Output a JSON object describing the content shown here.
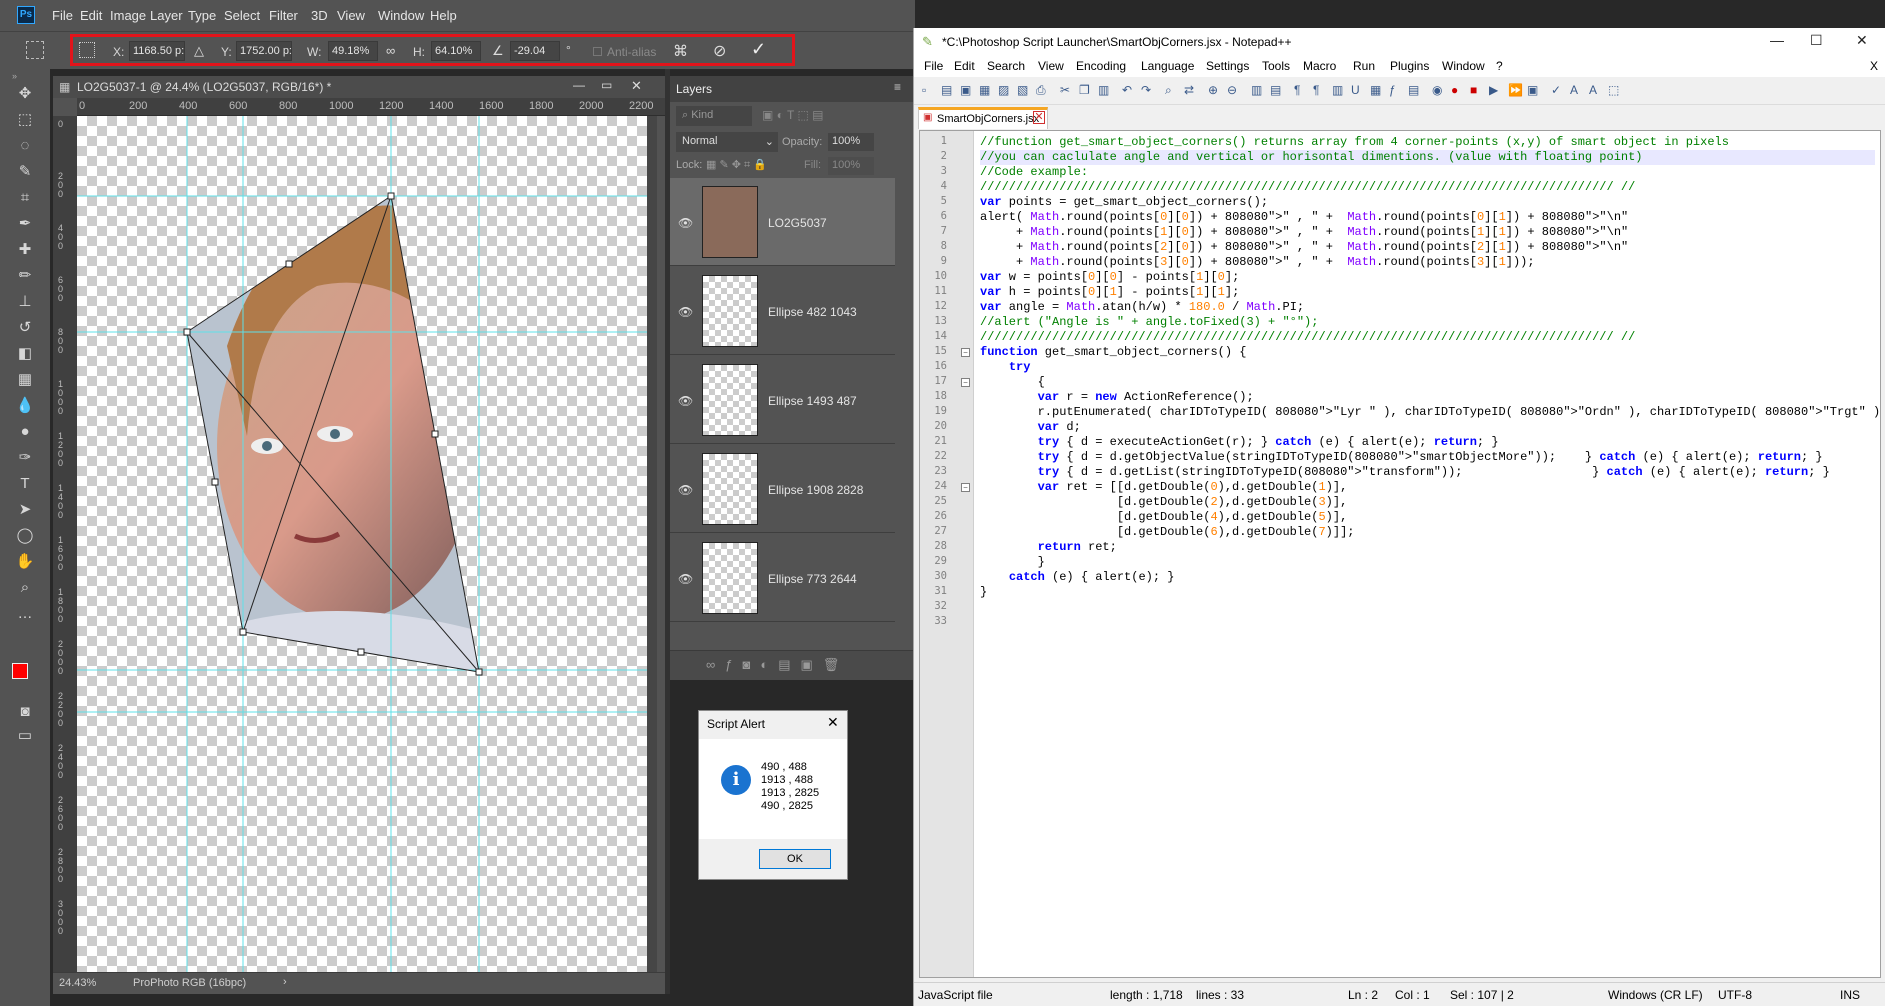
{
  "photoshop": {
    "logo": "Ps",
    "menu": [
      "File",
      "Edit",
      "Image",
      "Layer",
      "Type",
      "Select",
      "Filter",
      "3D",
      "View",
      "Window",
      "Help"
    ],
    "options": {
      "x_label": "X:",
      "x_value": "1168.50 p:",
      "y_label": "Y:",
      "y_value": "1752.00 p:",
      "w_label": "W:",
      "w_value": "49.18%",
      "h_label": "H:",
      "h_value": "64.10%",
      "angle_value": "-29.04",
      "angle_unit": "°",
      "antialias": "Anti-alias"
    },
    "document": {
      "title": "LO2G5037-1 @ 24.4% (LO2G5037, RGB/16*) *",
      "ruler_top": [
        "0",
        "200",
        "400",
        "600",
        "800",
        "1000",
        "1200",
        "1400",
        "1600",
        "1800",
        "2000",
        "2200"
      ],
      "ruler_left": [
        "0",
        "200",
        "400",
        "600",
        "800",
        "1000",
        "1200",
        "1400",
        "1600",
        "1800",
        "2000",
        "2200",
        "2400",
        "2600",
        "2800",
        "3000"
      ],
      "zoom": "24.43%",
      "profile": "ProPhoto RGB (16bpc)"
    },
    "layers": {
      "tab": "Layers",
      "kind": "Kind",
      "blend": "Normal",
      "opacity_label": "Opacity:",
      "opacity": "100%",
      "lock_label": "Lock:",
      "fill_label": "Fill:",
      "fill": "100%",
      "items": [
        {
          "name": "LO2G5037",
          "selected": true
        },
        {
          "name": "Ellipse 482 1043",
          "selected": false
        },
        {
          "name": "Ellipse 1493 487",
          "selected": false
        },
        {
          "name": "Ellipse 1908 2828",
          "selected": false
        },
        {
          "name": "Ellipse 773 2644",
          "selected": false
        }
      ]
    },
    "alert": {
      "title": "Script Alert",
      "lines": [
        "490 , 488",
        "1913 , 488",
        "1913 , 2825",
        "490 , 2825"
      ],
      "ok": "OK"
    }
  },
  "notepad": {
    "title": "*C:\\Photoshop Script Launcher\\SmartObjCorners.jsx - Notepad++",
    "menu": [
      "File",
      "Edit",
      "Search",
      "View",
      "Encoding",
      "Language",
      "Settings",
      "Tools",
      "Macro",
      "Run",
      "Plugins",
      "Window",
      "?"
    ],
    "close_x": "X",
    "tab": "SmartObjCorners.jsx",
    "lines": [
      "//function get_smart_object_corners() returns array from 4 corner-points (x,y) of smart object in pixels",
      "//you can caclulate angle and vertical or horisontal dimentions. (value with floating point)",
      "//Code example:",
      "//////////////////////////////////////////////////////////////////////////////////////// //",
      "var points = get_smart_object_corners();",
      "alert( Math.round(points[0][0]) + \" , \" +  Math.round(points[0][1]) + \"\\n\"",
      "     + Math.round(points[1][0]) + \" , \" +  Math.round(points[1][1]) + \"\\n\"",
      "     + Math.round(points[2][0]) + \" , \" +  Math.round(points[2][1]) + \"\\n\"",
      "     + Math.round(points[3][0]) + \" , \" +  Math.round(points[3][1]));",
      "var w = points[0][0] - points[1][0];",
      "var h = points[0][1] - points[1][1];",
      "var angle = Math.atan(h/w) * 180.0 / Math.PI;",
      "//alert (\"Angle is \" + angle.toFixed(3) + \"°\");",
      "//////////////////////////////////////////////////////////////////////////////////////// //",
      "function get_smart_object_corners() {",
      "    try",
      "        {",
      "        var r = new ActionReference();",
      "        r.putEnumerated( charIDToTypeID( \"Lyr \" ), charIDToTypeID( \"Ordn\" ), charIDToTypeID( \"Trgt\" ) );",
      "        var d;",
      "        try { d = executeActionGet(r); } catch (e) { alert(e); return; }",
      "        try { d = d.getObjectValue(stringIDToTypeID(\"smartObjectMore\"));    } catch (e) { alert(e); return; }",
      "        try { d = d.getList(stringIDToTypeID(\"transform\"));                  } catch (e) { alert(e); return; }",
      "        var ret = [[d.getDouble(0),d.getDouble(1)],",
      "                   [d.getDouble(2),d.getDouble(3)],",
      "                   [d.getDouble(4),d.getDouble(5)],",
      "                   [d.getDouble(6),d.getDouble(7)]];",
      "        return ret;",
      "        }",
      "    catch (e) { alert(e); }",
      "}",
      "",
      ""
    ],
    "status": {
      "type": "JavaScript file",
      "length": "length : 1,718",
      "lines": "lines : 33",
      "ln": "Ln : 2",
      "col": "Col : 1",
      "sel": "Sel : 107 | 2",
      "eol": "Windows (CR LF)",
      "enc": "UTF-8",
      "ins": "INS"
    }
  },
  "colors": {
    "ps_bg": "#535353",
    "highlight": "#e2141b",
    "guide": "#5ee0e8",
    "npp_comment": "#008000",
    "npp_keyword": "#0000ff"
  }
}
